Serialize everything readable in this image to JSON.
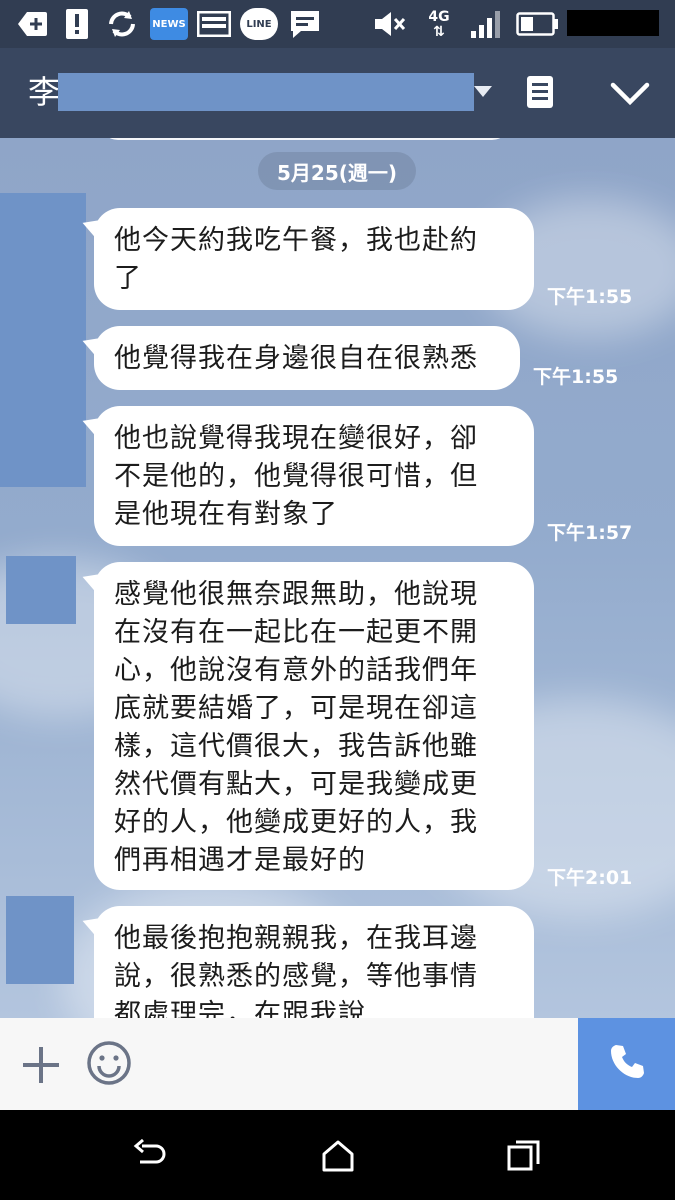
{
  "status_bar": {
    "network_label": "4G",
    "news_label": "NEWS",
    "line_label": "LINE",
    "icons": [
      "add-box-icon",
      "alert-icon",
      "sync-icon",
      "news-app-icon",
      "image-icon",
      "line-app-icon",
      "message-icon",
      "mute-icon",
      "network-4g-icon",
      "signal-icon",
      "battery-icon"
    ]
  },
  "header": {
    "title": "李"
  },
  "chat": {
    "date_label": "5月25(週一)",
    "messages": [
      {
        "text": "他今天約我吃午餐，我也赴約\n了",
        "time": "下午1:55"
      },
      {
        "text": "他覺得我在身邊很自在很熟悉",
        "time": "下午1:55"
      },
      {
        "text": "他也說覺得我現在變很好，卻\n不是他的，他覺得很可惜，但\n是他現在有對象了",
        "time": "下午1:57"
      },
      {
        "text": "感覺他很無奈跟無助，他說現\n在沒有在一起比在一起更不開\n心，他說沒有意外的話我們年\n底就要結婚了，可是現在卻這\n樣，這代價很大，我告訴他雖\n然代價有點大，可是我變成更\n好的人，他變成更好的人，我\n們再相遇才是最好的",
        "time": "下午2:01"
      },
      {
        "text": "他最後抱抱親親我，在我耳邊\n說，很熟悉的感覺，等他事情\n都處理完，在跟我說",
        "time": ""
      }
    ]
  },
  "colors": {
    "header_bg": "#394760",
    "status_bg": "#313d52",
    "call_button": "#5d92e1",
    "redaction": "#6f93c7"
  }
}
